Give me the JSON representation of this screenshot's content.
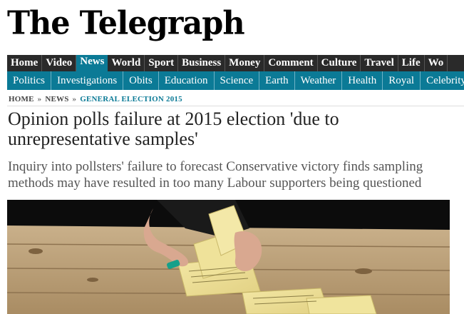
{
  "logo": "The Telegraph",
  "nav_primary": [
    "Home",
    "Video",
    "News",
    "World",
    "Sport",
    "Business",
    "Money",
    "Comment",
    "Culture",
    "Travel",
    "Life",
    "Wo"
  ],
  "nav_primary_active": "News",
  "nav_secondary": [
    "Politics",
    "Investigations",
    "Obits",
    "Education",
    "Science",
    "Earth",
    "Weather",
    "Health",
    "Royal",
    "Celebrity"
  ],
  "breadcrumb": {
    "home": "HOME",
    "news": "NEWS",
    "current": "GENERAL ELECTION 2015",
    "separator": "»"
  },
  "article": {
    "headline": "Opinion polls failure at 2015 election 'due to unrepresentative samples'",
    "standfirst": "Inquiry into pollsters' failure to forecast Conservative victory finds sampling methods may have resulted in too many Labour supporters being questioned"
  },
  "colors": {
    "nav_dark": "#2a2a2a",
    "accent_teal": "#0b7a96"
  }
}
